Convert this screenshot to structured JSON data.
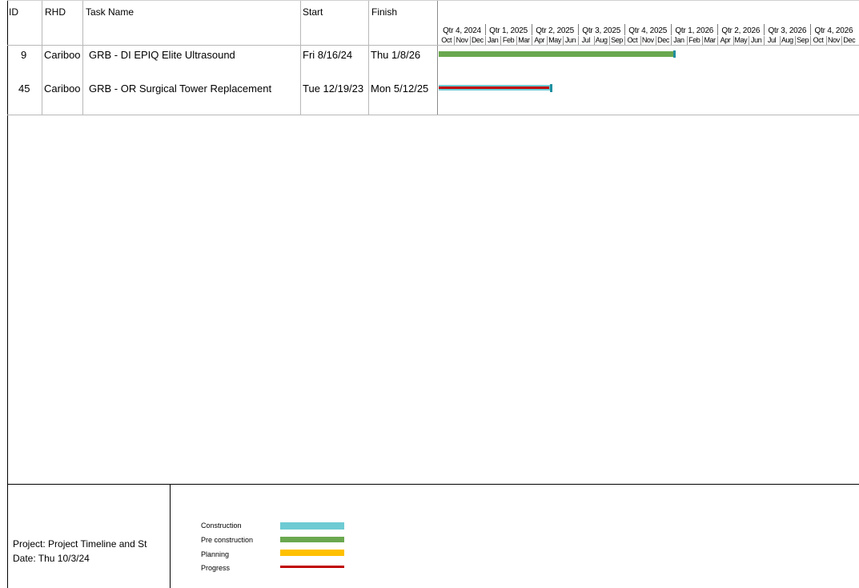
{
  "columns": {
    "id": "ID",
    "rhd": "RHD",
    "task_name": "Task Name",
    "start": "Start",
    "finish": "Finish"
  },
  "timescale": {
    "quarters": [
      "Qtr 4, 2024",
      "Qtr 1, 2025",
      "Qtr 2, 2025",
      "Qtr 3, 2025",
      "Qtr 4, 2025",
      "Qtr 1, 2026",
      "Qtr 2, 2026",
      "Qtr 3, 2026",
      "Qtr 4, 2026"
    ],
    "months": [
      "Oct",
      "Nov",
      "Dec",
      "Jan",
      "Feb",
      "Mar",
      "Apr",
      "May",
      "Jun",
      "Jul",
      "Aug",
      "Sep",
      "Oct",
      "Nov",
      "Dec",
      "Jan",
      "Feb",
      "Mar",
      "Apr",
      "May",
      "Jun",
      "Jul",
      "Aug",
      "Sep",
      "Oct",
      "Nov",
      "Dec"
    ]
  },
  "tasks": [
    {
      "id": "9",
      "rhd": "Cariboo",
      "name": "GRB - DI EPIQ Elite Ultrasound",
      "start": "Fri 8/16/24",
      "finish": "Thu 1/8/26",
      "bar_type": "Pre construction"
    },
    {
      "id": "45",
      "rhd": "Cariboo",
      "name": "GRB - OR Surgical Tower Replacement",
      "start": "Tue 12/19/23",
      "finish": "Mon 5/12/25",
      "bar_type": "Construction",
      "progress": "complete"
    }
  ],
  "legend": [
    {
      "label": "Construction",
      "color": "#6ecbd3"
    },
    {
      "label": "Pre construction",
      "color": "#6aa84f"
    },
    {
      "label": "Planning",
      "color": "#ffc000"
    },
    {
      "label": "Progress",
      "color": "#c00000"
    }
  ],
  "footer": {
    "project": "Project: Project Timeline and St",
    "date": "Date: Thu 10/3/24"
  },
  "colors": {
    "construction": "#6ecbd3",
    "pre_construction": "#6aa84f",
    "planning": "#ffc000",
    "progress": "#c00000",
    "milestone_tick": "#1f8fa0"
  }
}
